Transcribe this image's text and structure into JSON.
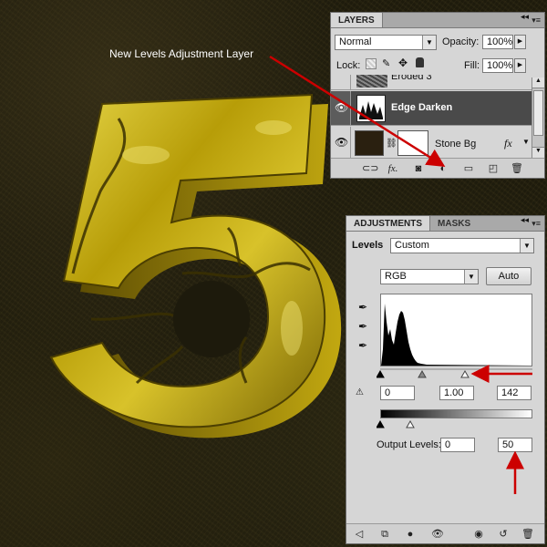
{
  "annotation": {
    "text": "New Levels Adjustment Layer"
  },
  "artwork": {
    "digit": "5",
    "fill_color": "#c9b010",
    "shadow_color": "#6d5a05"
  },
  "accent_color": "#cc0000",
  "layers_panel": {
    "tab_label": "LAYERS",
    "blend_mode": "Normal",
    "opacity_label": "Opacity:",
    "opacity_value": "100%",
    "lock_label": "Lock:",
    "fill_label": "Fill:",
    "fill_value": "100%",
    "layers": [
      {
        "name": "Eroded 3",
        "visible": false,
        "selected": false
      },
      {
        "name": "Edge Darken",
        "visible": true,
        "selected": true
      },
      {
        "name": "Stone Bg",
        "visible": true,
        "selected": false,
        "fx": "fx"
      }
    ],
    "footer_icons": [
      "link-icon",
      "fx-icon",
      "mask-icon",
      "adjustment-layer-icon",
      "folder-icon",
      "new-layer-icon",
      "trash-icon"
    ]
  },
  "adjustments_panel": {
    "tabs": [
      "ADJUSTMENTS",
      "MASKS"
    ],
    "title": "Levels",
    "preset": "Custom",
    "channel": "RGB",
    "auto_label": "Auto",
    "input_levels": {
      "black": "0",
      "gamma": "1.00",
      "white": "142"
    },
    "output_levels_label": "Output Levels:",
    "output_levels": {
      "black": "0",
      "white": "50"
    },
    "footer_icons": [
      "back-icon",
      "clip-icon",
      "mask-visibility-icon",
      "eye-icon",
      "view-previous-icon",
      "reset-icon",
      "trash-icon"
    ]
  }
}
